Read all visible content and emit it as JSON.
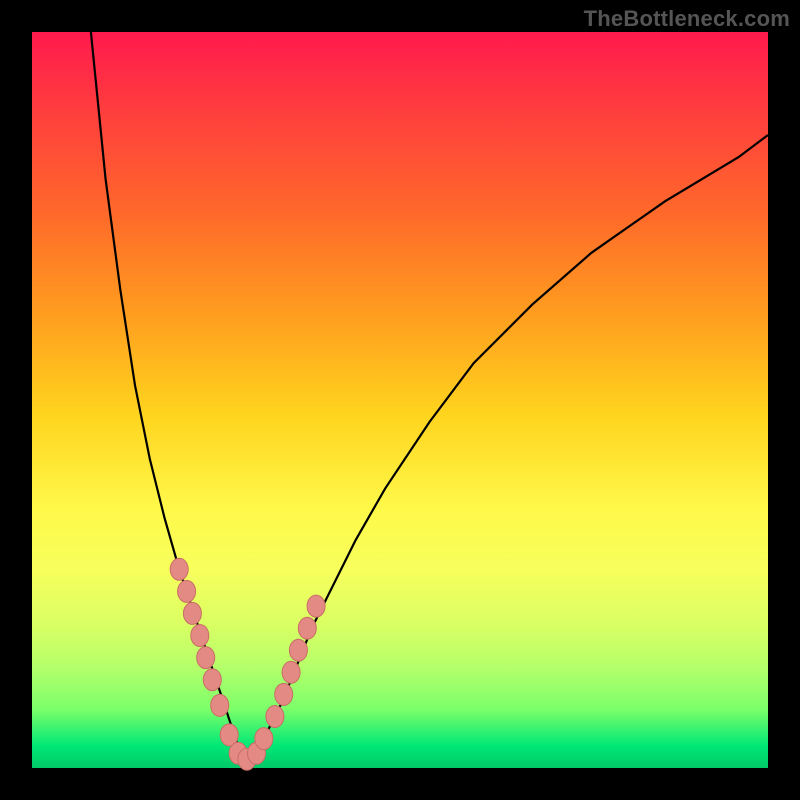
{
  "watermark": "TheBottleneck.com",
  "colors": {
    "background": "#000000",
    "gradient_top": "#ff1a4d",
    "gradient_bottom": "#00c868",
    "curve_stroke": "#000000",
    "marker_fill": "#e48a85",
    "marker_stroke": "#c96d66"
  },
  "chart_data": {
    "type": "line",
    "title": "",
    "xlabel": "",
    "ylabel": "",
    "xlim": [
      0,
      100
    ],
    "ylim": [
      0,
      100
    ],
    "series": [
      {
        "name": "left-branch",
        "x": [
          8,
          10,
          12,
          14,
          16,
          18,
          20,
          21,
          22,
          23,
          24,
          25,
          26,
          27,
          28,
          29
        ],
        "y": [
          100,
          80,
          65,
          52,
          42,
          34,
          27,
          24,
          21,
          18,
          15,
          12,
          9,
          6,
          3,
          1
        ]
      },
      {
        "name": "right-branch",
        "x": [
          29,
          30,
          32,
          34,
          36,
          38,
          40,
          44,
          48,
          54,
          60,
          68,
          76,
          86,
          96,
          100
        ],
        "y": [
          1,
          2,
          5,
          9,
          14,
          19,
          23,
          31,
          38,
          47,
          55,
          63,
          70,
          77,
          83,
          86
        ]
      }
    ],
    "markers": {
      "name": "highlight-points",
      "x": [
        20.0,
        21.0,
        21.8,
        22.8,
        23.6,
        24.5,
        25.5,
        26.8,
        28.0,
        29.2,
        30.5,
        31.5,
        33.0,
        34.2,
        35.2,
        36.2,
        37.4,
        38.6
      ],
      "y": [
        27.0,
        24.0,
        21.0,
        18.0,
        15.0,
        12.0,
        8.5,
        4.5,
        2.0,
        1.2,
        2.0,
        4.0,
        7.0,
        10.0,
        13.0,
        16.0,
        19.0,
        22.0
      ]
    }
  }
}
